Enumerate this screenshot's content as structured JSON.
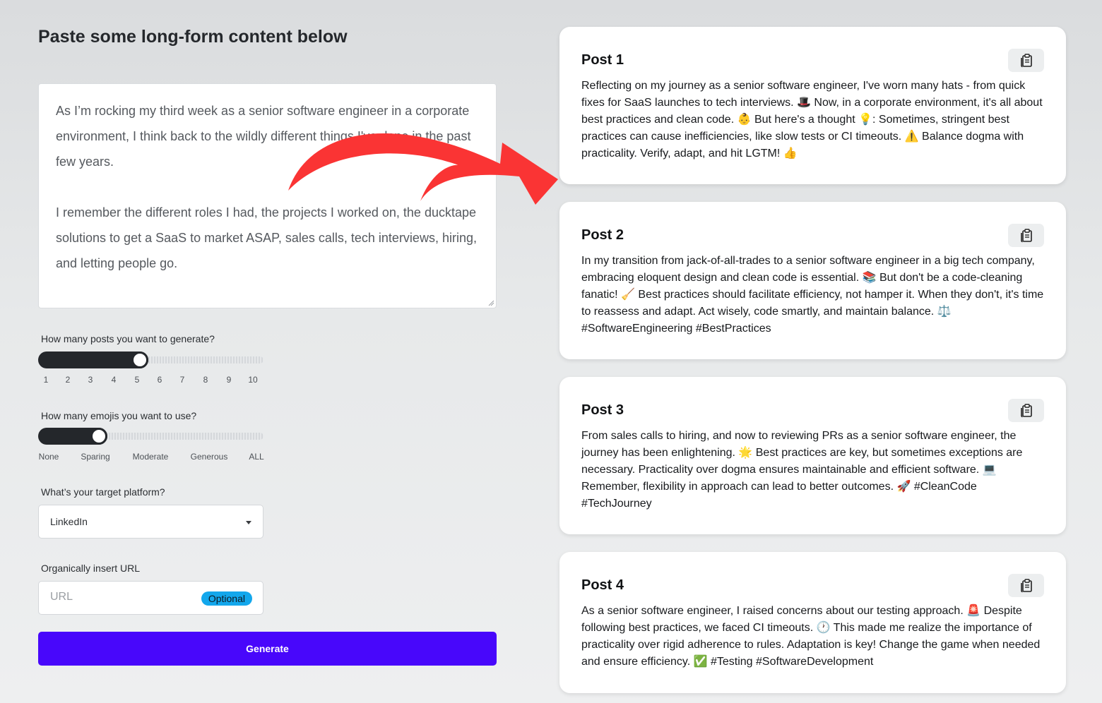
{
  "page_title": "Paste some long-form content below",
  "content": {
    "text": "As I’m rocking my third week as a senior software engineer in a corporate environment, I think back to the wildly different things I've done in the past few years.\n\nI remember the different roles I had, the projects I worked on, the ducktape solutions to get a SaaS to market ASAP, sales calls, tech interviews, hiring, and letting people go.\n\nI’m a jack-of-all-trades with a builder's fit and short experience"
  },
  "posts_slider": {
    "label": "How many posts you want to generate?",
    "value": 5,
    "min": 1,
    "max": 10,
    "ticks": [
      "1",
      "2",
      "3",
      "4",
      "5",
      "6",
      "7",
      "8",
      "9",
      "10"
    ]
  },
  "emojis_slider": {
    "label": "How many emojis you want to use?",
    "value_label": "Sparing",
    "ticks": [
      "None",
      "Sparing",
      "Moderate",
      "Generous",
      "ALL"
    ]
  },
  "platform": {
    "label": "What’s your target platform?",
    "value": "LinkedIn"
  },
  "url_field": {
    "label": "Organically insert URL",
    "placeholder": "URL",
    "badge": "Optional"
  },
  "generate_label": "Generate",
  "colors": {
    "accent": "#4807fb",
    "badge": "#13a7ec",
    "arrow": "#fa3434",
    "slider": "#24272b"
  },
  "posts": [
    {
      "title": "Post 1",
      "body": "Reflecting on my journey as a senior software engineer, I've worn many hats - from quick fixes for SaaS launches to tech interviews. 🎩 Now, in a corporate environment, it's all about best practices and clean code. 👶 But here's a thought 💡: Sometimes, stringent best practices can cause inefficiencies, like slow tests or CI timeouts. ⚠️ Balance dogma with practicality. Verify, adapt, and hit LGTM! 👍"
    },
    {
      "title": "Post 2",
      "body": "In my transition from jack-of-all-trades to a senior software engineer in a big tech company, embracing eloquent design and clean code is essential. 📚 But don't be a code-cleaning fanatic! 🧹 Best practices should facilitate efficiency, not hamper it. When they don't, it's time to reassess and adapt. Act wisely, code smartly, and maintain balance. ⚖️ #SoftwareEngineering #BestPractices"
    },
    {
      "title": "Post 3",
      "body": "From sales calls to hiring, and now to reviewing PRs as a senior software engineer, the journey has been enlightening. 🌟 Best practices are key, but sometimes exceptions are necessary. Practicality over dogma ensures maintainable and efficient software. 💻 Remember, flexibility in approach can lead to better outcomes. 🚀 #CleanCode #TechJourney"
    },
    {
      "title": "Post 4",
      "body": "As a senior software engineer, I raised concerns about our testing approach. 🚨 Despite following best practices, we faced CI timeouts. 🕐 This made me realize the importance of practicality over rigid adherence to rules. Adaptation is key! Change the game when needed and ensure efficiency. ✅ #Testing #SoftwareDevelopment"
    }
  ]
}
